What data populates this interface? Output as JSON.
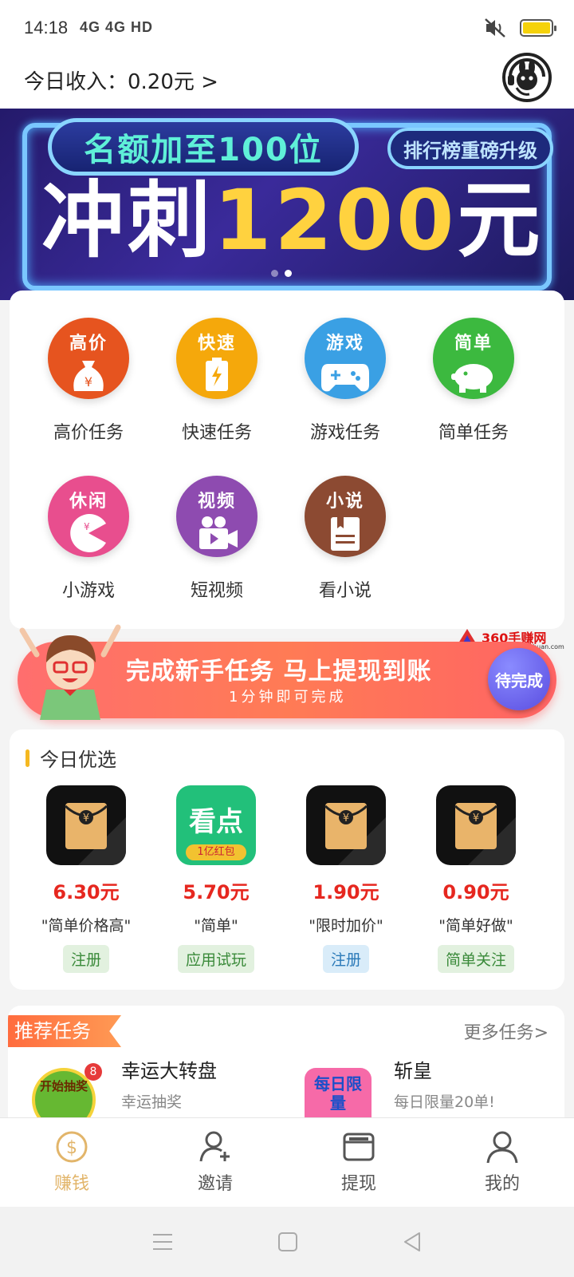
{
  "status_bar": {
    "time": "14:18",
    "signals": "4G 4G HD",
    "battery_color": "#f5d20a"
  },
  "header": {
    "income_text": "今日收入：0.20元 >",
    "service_icon": "rabbit-headset-icon"
  },
  "banner": {
    "pill_text": "名额加至100位",
    "tag_text": "排行榜重磅升级",
    "big_prefix": "冲刺",
    "big_number": "1200",
    "big_suffix": "元",
    "active_dot": 1
  },
  "tasks": [
    {
      "badge": "高价",
      "label": "高价任务",
      "color": "#e6541f"
    },
    {
      "badge": "快速",
      "label": "快速任务",
      "color": "#f5a80b"
    },
    {
      "badge": "游戏",
      "label": "游戏任务",
      "color": "#3aa0e4"
    },
    {
      "badge": "简单",
      "label": "简单任务",
      "color": "#3cb93f"
    },
    {
      "badge": "休闲",
      "label": "小游戏",
      "color": "#e84e8e"
    },
    {
      "badge": "视频",
      "label": "短视频",
      "color": "#8e4bb0"
    },
    {
      "badge": "小说",
      "label": "看小说",
      "color": "#8c4a32"
    }
  ],
  "promo": {
    "title": "完成新手任务 马上提现到账",
    "subtitle": "1分钟即可完成",
    "button": "待完成",
    "watermark_text": "360手赚网",
    "watermark_url": "www.360shouzhuan.com"
  },
  "picks": {
    "title": "今日优选",
    "items": [
      {
        "price": "6.30元",
        "desc": "\"简单价格高\"",
        "tag": "注册",
        "tag_style": "green",
        "icon": "red-envelope-icon",
        "icon_text": ""
      },
      {
        "price": "5.70元",
        "desc": "\"简单\"",
        "tag": "应用试玩",
        "tag_style": "green",
        "icon": "kandian-app-icon",
        "icon_text": "看点",
        "icon_sub": "1亿红包"
      },
      {
        "price": "1.90元",
        "desc": "\"限时加价\"",
        "tag": "注册",
        "tag_style": "blue",
        "icon": "red-envelope-icon",
        "icon_text": ""
      },
      {
        "price": "0.90元",
        "desc": "\"简单好做\"",
        "tag": "简单关注",
        "tag_style": "green",
        "icon": "red-envelope-icon",
        "icon_text": ""
      }
    ]
  },
  "recommended": {
    "title": "推荐任务",
    "more": "更多任务>",
    "items": [
      {
        "name": "幸运大转盘",
        "sub": "幸运抽奖",
        "icon_text": "开始抽奖",
        "badge": "8"
      },
      {
        "name": "斩皇",
        "sub": "每日限量20单!",
        "icon_text": "每日限量"
      }
    ]
  },
  "tabbar": [
    {
      "label": "赚钱",
      "icon": "dollar-coin-icon",
      "active": true
    },
    {
      "label": "邀请",
      "icon": "add-user-icon",
      "active": false
    },
    {
      "label": "提现",
      "icon": "wallet-icon",
      "active": false
    },
    {
      "label": "我的",
      "icon": "user-icon",
      "active": false
    }
  ]
}
